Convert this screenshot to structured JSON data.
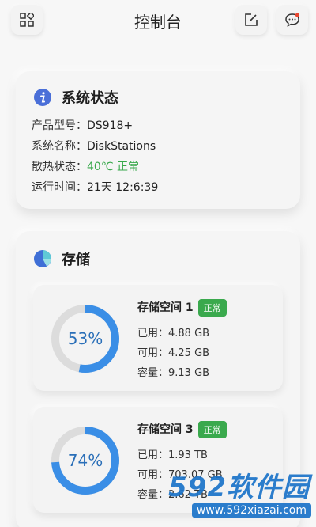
{
  "header": {
    "title": "控制台",
    "left_icon": "apps-grid-icon",
    "right_icons": [
      "edit-icon",
      "message-icon"
    ]
  },
  "system": {
    "title": "系统状态",
    "icon": "info-icon",
    "rows": [
      {
        "label": "产品型号：",
        "value": "DS918+"
      },
      {
        "label": "系统名称：",
        "value": "DiskStations"
      },
      {
        "label": "散热状态：",
        "value": "40℃ 正常"
      },
      {
        "label": "运行时间：",
        "value": "21天 12:6:39"
      }
    ]
  },
  "storage": {
    "title": "存储",
    "icon": "pie-chart-icon",
    "volumes": [
      {
        "name": "存储空间 1",
        "status": "正常",
        "percent": "53%",
        "used_fraction": 0.53,
        "used": "已用：4.88 GB",
        "avail": "可用：4.25 GB",
        "cap": "容量：9.13 GB"
      },
      {
        "name": "存储空间 3",
        "status": "正常",
        "percent": "74%",
        "used_fraction": 0.74,
        "used": "已用：1.93 TB",
        "avail": "可用：703.07 GB",
        "cap": "容量：2.62 TB"
      }
    ]
  },
  "watermark": {
    "brand": "592软件园",
    "url": "www.592xiazai.com"
  },
  "colors": {
    "accent": "#3a8ee6",
    "ok": "#37a84a",
    "ring_track": "#dcdcdc"
  }
}
